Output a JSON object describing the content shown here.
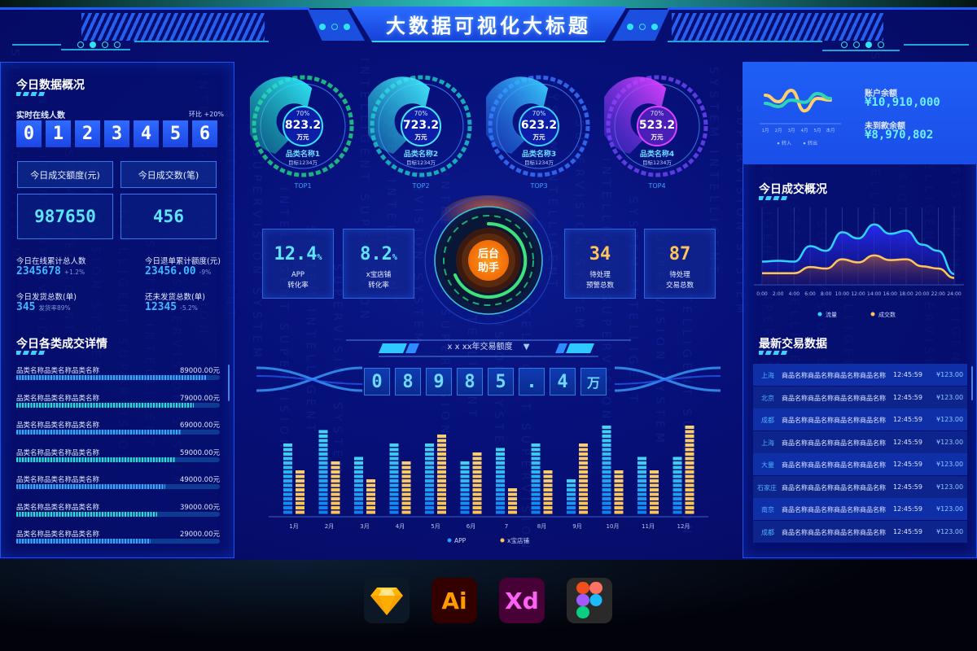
{
  "header": {
    "title": "大数据可视化大标题"
  },
  "left": {
    "overview_title": "今日数据概况",
    "online_label": "实时在线人数",
    "online_change": "环比 +20%",
    "online_digits": [
      "0",
      "1",
      "2",
      "3",
      "4",
      "5",
      "6"
    ],
    "amount_label": "今日成交额度(元)",
    "count_label": "今日成交数(笔)",
    "amount_value": "987650",
    "count_value": "456",
    "stats": [
      {
        "label": "今日在线累计总人数",
        "value": "2345678",
        "note": "+1.2%"
      },
      {
        "label": "今日退单累计额度(元)",
        "value": "23456.00",
        "note": "-9%"
      },
      {
        "label": "今日发货总数(单)",
        "value": "345",
        "note": "发货率89%"
      },
      {
        "label": "还未发货总数(单)",
        "value": "12345",
        "note": "-5.2%"
      }
    ],
    "category_title": "今日各类成交详情",
    "categories": [
      {
        "name": "品类名称品类名称品类名称",
        "value": "89000.00元",
        "ratio": 0.93,
        "color": "#3aa8ff"
      },
      {
        "name": "品类名称品类名称品类名称",
        "value": "79000.00元",
        "ratio": 0.87,
        "color": "#2ee0d0"
      },
      {
        "name": "品类名称品类名称品类名称",
        "value": "69000.00元",
        "ratio": 0.81,
        "color": "#3aa8ff"
      },
      {
        "name": "品类名称品类名称品类名称",
        "value": "59000.00元",
        "ratio": 0.78,
        "color": "#2ee0d0"
      },
      {
        "name": "品类名称品类名称品类名称",
        "value": "49000.00元",
        "ratio": 0.73,
        "color": "#3aa8ff"
      },
      {
        "name": "品类名称品类名称品类名称",
        "value": "39000.00元",
        "ratio": 0.69,
        "color": "#2ee0d0"
      },
      {
        "name": "品类名称品类名称品类名称",
        "value": "29000.00元",
        "ratio": 0.66,
        "color": "#3aa8ff"
      }
    ]
  },
  "gauges": [
    {
      "percent": "70%",
      "value": "823.2",
      "unit": "万元",
      "name": "品类名称1",
      "target": "目标1234万",
      "rank": "TOP1",
      "ratio": 0.7,
      "c1": "#1ad39a",
      "c2": "#2fe7ff",
      "ring": "#1bb37f"
    },
    {
      "percent": "70%",
      "value": "723.2",
      "unit": "万元",
      "name": "品类名称2",
      "target": "目标1234万",
      "rank": "TOP2",
      "ratio": 0.7,
      "c1": "#22c3d8",
      "c2": "#44eaff",
      "ring": "#18a9b8"
    },
    {
      "percent": "70%",
      "value": "623.2",
      "unit": "万元",
      "name": "品类名称3",
      "target": "目标1234万",
      "rank": "TOP3",
      "ratio": 0.7,
      "c1": "#2a6cff",
      "c2": "#3ad0ff",
      "ring": "#2f62e8"
    },
    {
      "percent": "70%",
      "value": "523.2",
      "unit": "万元",
      "name": "品类名称4",
      "target": "目标1234万",
      "rank": "TOP4",
      "ratio": 0.7,
      "c1": "#6a3cff",
      "c2": "#e040ff",
      "ring": "#5a3be0"
    }
  ],
  "middle_cards": [
    {
      "value": "12.4",
      "suffix": "%",
      "label": "APP\n转化率",
      "color": "#5fe4ff"
    },
    {
      "value": "8.2",
      "suffix": "%",
      "label": "x宝店铺\n转化率",
      "color": "#5fe4ff"
    },
    {
      "value": "34",
      "suffix": "",
      "label": "待处理\n预警总数",
      "color": "#ffc45a"
    },
    {
      "value": "87",
      "suffix": "",
      "label": "待处理\n交易总数",
      "color": "#ffc45a"
    }
  ],
  "assistant": {
    "label_line1": "后台",
    "label_line2": "助手"
  },
  "trade_counter": {
    "year_label": "x x xx年交易额度",
    "digits": [
      "0",
      "8",
      "9",
      "8",
      "5",
      ".",
      "4",
      "万"
    ]
  },
  "chart_data": [
    {
      "type": "bar",
      "title": "",
      "categories": [
        "1月",
        "2月",
        "3月",
        "4月",
        "5月",
        "6月",
        "7",
        "8月",
        "9月",
        "10月",
        "11月",
        "12月"
      ],
      "series": [
        {
          "name": "APP",
          "values": [
            79,
            91,
            63,
            77,
            79,
            57,
            72,
            79,
            38,
            96,
            63,
            64
          ],
          "color": "#2f9bff"
        },
        {
          "name": "x宝店铺",
          "values": [
            50,
            58,
            40,
            56,
            85,
            67,
            30,
            50,
            79,
            50,
            50,
            97
          ],
          "color": "#ffd27a"
        }
      ],
      "ylim": [
        0,
        100
      ],
      "legend": "bottom"
    },
    {
      "type": "area",
      "title": "今日成交概况",
      "x": [
        "0:00",
        "2:00",
        "4:00",
        "6:00",
        "8:00",
        "10:00",
        "12:00",
        "14:00",
        "16:00",
        "18:00",
        "20:00",
        "22:00",
        "24:00"
      ],
      "series": [
        {
          "name": "流量",
          "values": [
            30,
            31,
            30,
            50,
            44,
            68,
            60,
            78,
            66,
            70,
            52,
            44,
            14
          ],
          "color": "#2fd3ff"
        },
        {
          "name": "成交数",
          "values": [
            15,
            15,
            15,
            23,
            21,
            33,
            29,
            38,
            32,
            33,
            24,
            21,
            9
          ],
          "color": "#ffc45a"
        }
      ],
      "ylim": [
        0,
        100
      ],
      "legend": "bottom"
    },
    {
      "type": "line",
      "title": "",
      "x": [
        "1月",
        "2月",
        "3月",
        "4月",
        "5月",
        "本月"
      ],
      "series": [
        {
          "name": "转入",
          "values": [
            70,
            50,
            85,
            22,
            60,
            55
          ],
          "color": "#ffcf6a"
        },
        {
          "name": "转出",
          "values": [
            45,
            35,
            55,
            48,
            75,
            60
          ],
          "color": "#2fd3b5"
        }
      ],
      "ylim": [
        0,
        100
      ],
      "legend": "bottom"
    }
  ],
  "right": {
    "balance_label": "账户余额",
    "balance_value": "¥10,910,000",
    "pending_label": "未到款余额",
    "pending_value": "¥8,970,802",
    "overview_title": "今日成交概况",
    "latest_title": "最新交易数据",
    "transactions": [
      {
        "city": "上海",
        "product": "商品名称商品名称商品名称商品名称",
        "time": "12:45:59",
        "amount": "¥123.00"
      },
      {
        "city": "北京",
        "product": "商品名称商品名称商品名称商品名称",
        "time": "12:45:59",
        "amount": "¥123.00"
      },
      {
        "city": "成都",
        "product": "商品名称商品名称商品名称商品名称",
        "time": "12:45:59",
        "amount": "¥123.00"
      },
      {
        "city": "上海",
        "product": "商品名称商品名称商品名称商品名称",
        "time": "12:45:59",
        "amount": "¥123.00"
      },
      {
        "city": "大量",
        "product": "商品名称商品名称商品名称商品名称",
        "time": "12:45:59",
        "amount": "¥123.00"
      },
      {
        "city": "石家庄",
        "product": "商品名称商品名称商品名称商品名称",
        "time": "12:45:59",
        "amount": "¥123.00"
      },
      {
        "city": "南京",
        "product": "商品名称商品名称商品名称商品名称",
        "time": "12:45:59",
        "amount": "¥123.00"
      },
      {
        "city": "成都",
        "product": "商品名称商品名称商品名称商品名称",
        "time": "12:45:59",
        "amount": "¥123.00"
      }
    ]
  },
  "tools": [
    {
      "name": "Sketch",
      "label": ""
    },
    {
      "name": "Illustrator",
      "label": "Ai"
    },
    {
      "name": "XD",
      "label": "Xd"
    },
    {
      "name": "Figma",
      "label": ""
    }
  ]
}
